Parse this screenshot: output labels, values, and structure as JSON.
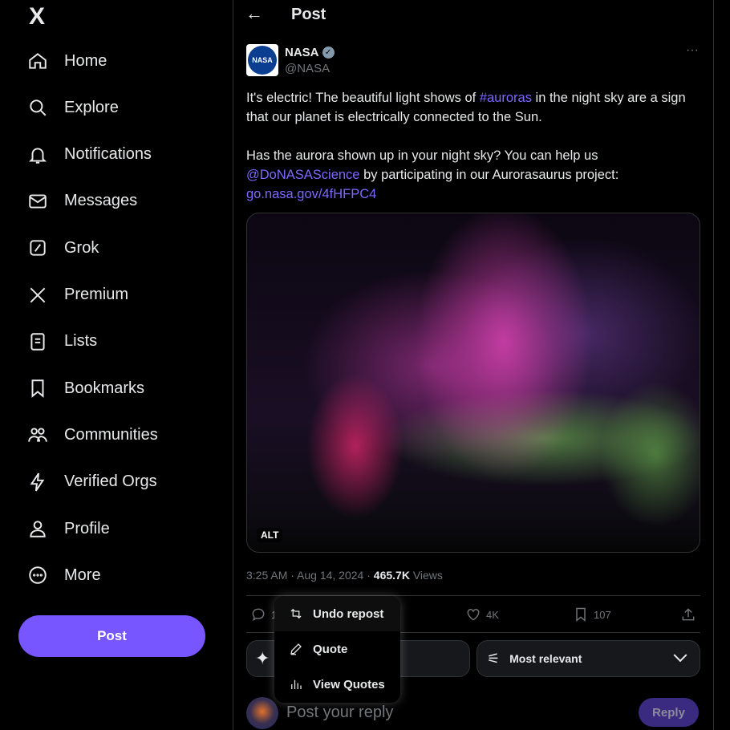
{
  "sidebar": {
    "logo": "X",
    "items": [
      {
        "label": "Home",
        "icon": "home-icon"
      },
      {
        "label": "Explore",
        "icon": "search-icon"
      },
      {
        "label": "Notifications",
        "icon": "bell-icon"
      },
      {
        "label": "Messages",
        "icon": "mail-icon"
      },
      {
        "label": "Grok",
        "icon": "grok-icon"
      },
      {
        "label": "Premium",
        "icon": "x-icon"
      },
      {
        "label": "Lists",
        "icon": "list-icon"
      },
      {
        "label": "Bookmarks",
        "icon": "bookmark-icon"
      },
      {
        "label": "Communities",
        "icon": "communities-icon"
      },
      {
        "label": "Verified Orgs",
        "icon": "lightning-icon"
      },
      {
        "label": "Profile",
        "icon": "person-icon"
      },
      {
        "label": "More",
        "icon": "more-circle-icon"
      }
    ],
    "post_label": "Post"
  },
  "header": {
    "title": "Post"
  },
  "tweet": {
    "author": "NASA",
    "handle": "@NASA",
    "text1a": "It's electric! The beautiful light shows of ",
    "hashtag": "#auroras",
    "text1b": " in the night sky are a sign that our planet is electrically connected to the Sun.",
    "text2a": "Has the aurora shown up in your night sky? You can help us ",
    "mention": "@DoNASAScience",
    "text2b": " by participating in our Aurorasaurus project:",
    "link": "go.nasa.gov/4fHFPC4",
    "alt_badge": "ALT",
    "time": "3:25 AM · Aug 14, 2024 · ",
    "views_count": "465.7K",
    "views_label": " Views"
  },
  "actions": {
    "replies": "1",
    "likes": "4K",
    "bookmarks": "107"
  },
  "menu": {
    "items": [
      "Undo repost",
      "Quote",
      "View Quotes"
    ]
  },
  "sort": {
    "label": "Most relevant"
  },
  "reply": {
    "placeholder": "Post your reply",
    "button": "Reply"
  },
  "colors": {
    "accent": "#7856ff",
    "link": "#7b68ff"
  }
}
